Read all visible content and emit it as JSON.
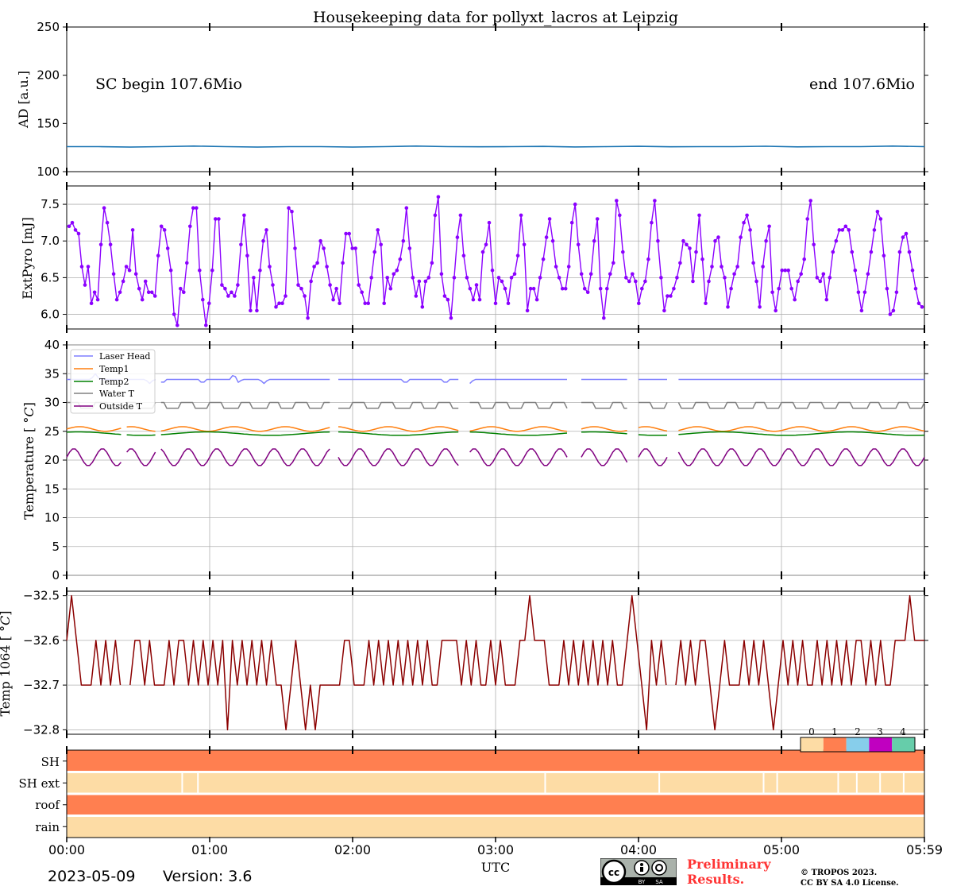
{
  "title": "Housekeeping data for pollyxt_lacros at Leipzig",
  "footer": {
    "date": "2023-05-09",
    "version": "Version: 3.6",
    "preliminary": [
      "Preliminary",
      "Results."
    ],
    "copyright": [
      "© TROPOS 2023.",
      "CC BY SA 4.0 License."
    ],
    "cc_badge": {
      "by": "BY",
      "sa": "SA"
    }
  },
  "colors": {
    "ad": "#1f77b4",
    "extpyro": "#8b00ff",
    "laser_head": "#7f7fff",
    "temp1": "#ff7f0e",
    "temp2": "#008000",
    "water": "#808080",
    "outside": "#800080",
    "temp1064": "#8b0000",
    "status": [
      "#fddca5",
      "#ff7f50",
      "#87ceeb",
      "#c000c0",
      "#66cdaa"
    ],
    "prelim": "#ff3333"
  },
  "chart_data": [
    {
      "type": "line",
      "ylabel": "AD [a.u.]",
      "ylim": [
        100,
        250
      ],
      "yticks": [
        "100",
        "150",
        "200",
        "250"
      ],
      "annotations": [
        "SC begin 107.6Mio",
        "end 107.6Mio"
      ],
      "series": [
        {
          "values": [
            126,
            126,
            125.5,
            126,
            126.5,
            126,
            125.5,
            126,
            126,
            125.5,
            126,
            126.5,
            126,
            125.8,
            126,
            126.2,
            125.6,
            126,
            126.3,
            125.8,
            126,
            126,
            126.4,
            125.7,
            126,
            126,
            126.5,
            126
          ]
        }
      ],
      "grid": false
    },
    {
      "type": "line",
      "ylabel": "ExtPyro [mJ]",
      "ylim": [
        5.8,
        7.75
      ],
      "yticks": [
        "6.0",
        "6.5",
        "7.0",
        "7.5"
      ],
      "series": [
        {
          "values": [
            7.2,
            7.25,
            7.15,
            7.1,
            6.65,
            6.4,
            6.65,
            6.15,
            6.3,
            6.2,
            6.95,
            7.45,
            7.25,
            6.95,
            6.55,
            6.2,
            6.3,
            6.45,
            6.65,
            6.6,
            7.15,
            6.55,
            6.35,
            6.2,
            6.45,
            6.3,
            6.3,
            6.25,
            6.8,
            7.2,
            7.15,
            6.9,
            6.6,
            6.0,
            5.85,
            6.35,
            6.3,
            6.7,
            7.2,
            7.45,
            7.45,
            6.6,
            6.2,
            5.85,
            6.15,
            6.6,
            7.3,
            7.3,
            6.4,
            6.35,
            6.25,
            6.3,
            6.25,
            6.4,
            6.95,
            7.35,
            6.8,
            6.05,
            6.5,
            6.05,
            6.6,
            7.0,
            7.15,
            6.65,
            6.4,
            6.1,
            6.15,
            6.15,
            6.25,
            7.45,
            7.4,
            6.9,
            6.4,
            6.35,
            6.25,
            5.95,
            6.45,
            6.65,
            6.7,
            7.0,
            6.9,
            6.65,
            6.4,
            6.2,
            6.35,
            6.15,
            6.7,
            7.1,
            7.1,
            6.9,
            6.9,
            6.4,
            6.3,
            6.15,
            6.15,
            6.5,
            6.85,
            7.15,
            6.95,
            6.15,
            6.5,
            6.35,
            6.55,
            6.6,
            6.75,
            7.0,
            7.45,
            6.9,
            6.5,
            6.25,
            6.45,
            6.1,
            6.45,
            6.5,
            6.7,
            7.35,
            7.6,
            6.55,
            6.25,
            6.2,
            5.95,
            6.5,
            7.05,
            7.35,
            6.8,
            6.5,
            6.35,
            6.2,
            6.4,
            6.2,
            6.85,
            6.95,
            7.25,
            6.6,
            6.15,
            6.5,
            6.45,
            6.35,
            6.15,
            6.5,
            6.55,
            6.8,
            7.35,
            6.95,
            6.05,
            6.35,
            6.35,
            6.2,
            6.5,
            6.75,
            7.05,
            7.3,
            7.0,
            6.65,
            6.5,
            6.35,
            6.35,
            6.65,
            7.25,
            7.5,
            6.95,
            6.55,
            6.35,
            6.3,
            6.55,
            7.0,
            7.3,
            6.35,
            5.95,
            6.35,
            6.55,
            6.7,
            7.55,
            7.35,
            6.85,
            6.5,
            6.45,
            6.55,
            6.45,
            6.15,
            6.35,
            6.45,
            6.75,
            7.25,
            7.55,
            7.0,
            6.5,
            6.05,
            6.25,
            6.25,
            6.35,
            6.5,
            6.7,
            7.0,
            6.95,
            6.9,
            6.45,
            6.85,
            7.35,
            6.75,
            6.15,
            6.45,
            6.65,
            7.0,
            7.05,
            6.65,
            6.5,
            6.1,
            6.35,
            6.55,
            6.65,
            7.05,
            7.25,
            7.35,
            7.15,
            6.7,
            6.45,
            6.1,
            6.65,
            7.0,
            7.2,
            6.3,
            6.05,
            6.35,
            6.6,
            6.6,
            6.6,
            6.35,
            6.2,
            6.45,
            6.55,
            6.75,
            7.3,
            7.55,
            6.95,
            6.5,
            6.45,
            6.55,
            6.2,
            6.5,
            6.85,
            7.0,
            7.15,
            7.15,
            7.2,
            7.15,
            6.85,
            6.6,
            6.3,
            6.05,
            6.3,
            6.55,
            6.85,
            7.15,
            7.4,
            7.3,
            6.8,
            6.35,
            6.0,
            6.05,
            6.3,
            6.85,
            7.05,
            7.1,
            6.85,
            6.6,
            6.35,
            6.15,
            6.1
          ]
        }
      ],
      "grid": true
    },
    {
      "type": "line",
      "ylabel": "Temperature [$^\\circ C$]",
      "ylim": [
        0,
        40
      ],
      "yticks": [
        "0",
        "5",
        "10",
        "15",
        "20",
        "25",
        "30",
        "35",
        "40"
      ],
      "legend_position": "top-left",
      "series": [
        {
          "name": "Laser Head",
          "base": 34,
          "spikes": [
            [
              0.2,
              35
            ],
            [
              0.58,
              33.3
            ],
            [
              0.67,
              33.3
            ],
            [
              0.95,
              33.3
            ],
            [
              1.17,
              35
            ],
            [
              1.2,
              33.5
            ],
            [
              1.38,
              33.3
            ],
            [
              2.37,
              33.3
            ],
            [
              2.65,
              33.3
            ],
            [
              2.82,
              33.3
            ]
          ]
        },
        {
          "name": "Temp1",
          "range": [
            25.0,
            25.8
          ]
        },
        {
          "name": "Temp2",
          "range": [
            24.3,
            24.9
          ]
        },
        {
          "name": "Water T",
          "range": [
            29.0,
            30.0
          ]
        },
        {
          "name": "Outside T",
          "range": [
            19.0,
            22.0
          ]
        }
      ],
      "grid": true
    },
    {
      "type": "line",
      "ylabel": "Temp 1064 [$^\\circ C$]",
      "ylim": [
        -32.81,
        -32.49
      ],
      "yticks": [
        "−32.5",
        "−32.6",
        "−32.7",
        "−32.8"
      ],
      "series": [
        {
          "values": [
            -32.6,
            -32.5,
            -32.6,
            -32.7,
            -32.7,
            -32.7,
            -32.6,
            -32.7,
            -32.6,
            -32.7,
            -32.6,
            -32.7,
            -32.6,
            -32.7,
            -32.6,
            -32.6,
            -32.7,
            -32.6,
            -32.7,
            -32.7,
            -32.7,
            -32.6,
            -32.7,
            -32.6,
            -32.6,
            -32.7,
            -32.6,
            -32.7,
            -32.6,
            -32.7,
            -32.6,
            -32.7,
            -32.6,
            -32.8,
            -32.6,
            -32.7,
            -32.6,
            -32.7,
            -32.6,
            -32.7,
            -32.6,
            -32.7,
            -32.6,
            -32.7,
            -32.7,
            -32.8,
            -32.7,
            -32.6,
            -32.7,
            -32.8,
            -32.7,
            -32.8,
            -32.7,
            -32.7,
            -32.7,
            -32.7,
            -32.7,
            -32.6,
            -32.6,
            -32.7,
            -32.7,
            -32.7,
            -32.6,
            -32.7,
            -32.6,
            -32.7,
            -32.6,
            -32.7,
            -32.6,
            -32.7,
            -32.6,
            -32.7,
            -32.6,
            -32.7,
            -32.6,
            -32.7,
            -32.7,
            -32.6,
            -32.6,
            -32.6,
            -32.6,
            -32.7,
            -32.6,
            -32.7,
            -32.6,
            -32.7,
            -32.7,
            -32.6,
            -32.7,
            -32.6,
            -32.7,
            -32.7,
            -32.7,
            -32.6,
            -32.6,
            -32.5,
            -32.6,
            -32.6,
            -32.6,
            -32.7,
            -32.7,
            -32.7,
            -32.6,
            -32.7,
            -32.6,
            -32.7,
            -32.6,
            -32.7,
            -32.6,
            -32.7,
            -32.6,
            -32.7,
            -32.6,
            -32.7,
            -32.7,
            -32.6,
            -32.5,
            -32.6,
            -32.7,
            -32.8,
            -32.6,
            -32.7,
            -32.6,
            -32.7,
            -32.6,
            -32.7,
            -32.6,
            -32.7,
            -32.6,
            -32.7,
            -32.6,
            -32.6,
            -32.7,
            -32.8,
            -32.7,
            -32.6,
            -32.7,
            -32.7,
            -32.7,
            -32.6,
            -32.7,
            -32.6,
            -32.7,
            -32.6,
            -32.7,
            -32.8,
            -32.7,
            -32.6,
            -32.7,
            -32.6,
            -32.7,
            -32.6,
            -32.7,
            -32.7,
            -32.6,
            -32.7,
            -32.6,
            -32.7,
            -32.6,
            -32.7,
            -32.6,
            -32.7,
            -32.6,
            -32.6,
            -32.7,
            -32.6,
            -32.7,
            -32.6,
            -32.7,
            -32.7,
            -32.6,
            -32.6,
            -32.6,
            -32.5,
            -32.6,
            -32.6,
            -32.6
          ]
        }
      ],
      "grid": true
    },
    {
      "type": "heatmap",
      "rows": [
        "SH",
        "SH ext",
        "roof",
        "rain"
      ],
      "colorbar_ticks": [
        "0",
        "1",
        "2",
        "3",
        "4"
      ],
      "row_levels": [
        1,
        0,
        1,
        0
      ],
      "sh_ext_breaks_hours": [
        0.808,
        0.918,
        3.347,
        4.145,
        4.875,
        4.97,
        5.397,
        5.527,
        5.69,
        5.855
      ],
      "xlabel": "UTC",
      "xticks": [
        "00:00",
        "01:00",
        "02:00",
        "03:00",
        "04:00",
        "05:00",
        "05:59"
      ],
      "xlim_hours": [
        0,
        6
      ]
    }
  ]
}
